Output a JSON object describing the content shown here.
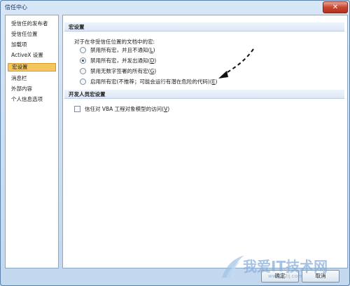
{
  "window": {
    "title": "信任中心",
    "close_symbol": "✕"
  },
  "sidebar": {
    "items": [
      {
        "label": "受信任的发布者"
      },
      {
        "label": "受信任位置"
      },
      {
        "label": "加载项"
      },
      {
        "label": "ActiveX 设置"
      },
      {
        "label": "宏设置",
        "selected": true
      },
      {
        "label": "消息栏"
      },
      {
        "label": "外部内容"
      },
      {
        "label": "个人信息选项"
      }
    ]
  },
  "macro": {
    "header": "宏设置",
    "intro": "对于在非受信任位置的文档中的宏:",
    "options": [
      {
        "label": "禁用所有宏，并且不通知(",
        "key": "L",
        "end": ")",
        "checked": false
      },
      {
        "label": "禁用所有宏，并发出通知(",
        "key": "D",
        "end": ")",
        "checked": true
      },
      {
        "label": "禁用无数字签署的所有宏(",
        "key": "G",
        "end": ")",
        "checked": false
      },
      {
        "label": "启用所有宏(不推荐；可能会运行有潜在危险的代码)(",
        "key": "E",
        "end": ")",
        "checked": false
      }
    ]
  },
  "developer": {
    "header": "开发人员宏设置",
    "vba_label": "信任对 VBA 工程对象模型的访问(",
    "vba_key": "V",
    "vba_end": ")",
    "vba_checked": false
  },
  "footer": {
    "ok_label": "确定",
    "cancel_label": "取消"
  },
  "watermark": {
    "text": "我爱IT技术网",
    "url": "www.52ij.com"
  },
  "colors": {
    "selected_item": "#f5c65b",
    "window_bg": "#c2d8ef",
    "close_button": "#c9452f"
  }
}
